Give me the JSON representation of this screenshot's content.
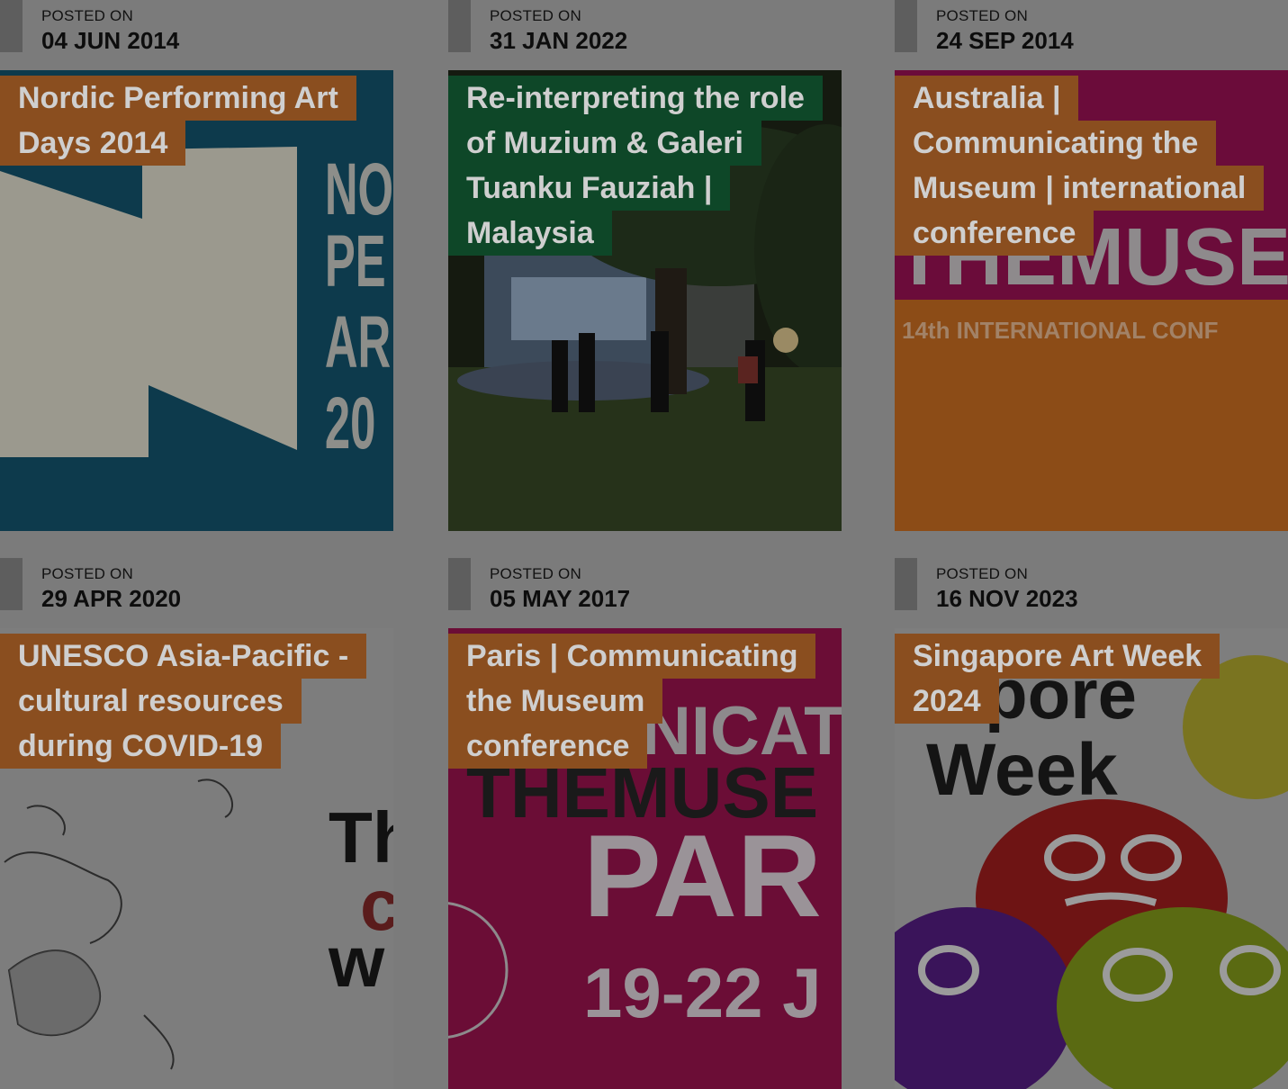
{
  "posted_label": "POSTED ON",
  "posts": [
    {
      "date": "04 JUN 2014",
      "title": "Nordic Performing Art Days 2014",
      "label_color": "#8a4e1f",
      "thumb_text": [
        "NO",
        "PE",
        "AR",
        "20"
      ]
    },
    {
      "date": "31 JAN 2022",
      "title": "Re-interpreting the role of Muzium & Galeri Tuanku Fauziah | Malaysia",
      "label_color": "#0e4728"
    },
    {
      "date": "24 SEP 2014",
      "title": "Australia | Communicating the Museum | international conference",
      "label_color": "#8a4e1f",
      "thumb_text": [
        "THEMUSEU",
        "14th INTERNATIONAL CONF"
      ]
    },
    {
      "date": "29 APR 2020",
      "title": "UNESCO Asia-Pacific - cultural resources during COVID-19",
      "label_color": "#8a4e1f",
      "thumb_text": [
        "Th",
        "c",
        "w"
      ]
    },
    {
      "date": "05 MAY 2017",
      "title": "Paris | Communicating the Museum conference",
      "label_color": "#8a4e1f",
      "thumb_text": [
        "NICAT",
        "THEMUSE",
        "PAR",
        "19-22 J"
      ]
    },
    {
      "date": "16 NOV 2023",
      "title": "Singapore Art Week 2024",
      "label_color": "#8a4e1f",
      "thumb_text": [
        "pore",
        "Week"
      ]
    }
  ]
}
